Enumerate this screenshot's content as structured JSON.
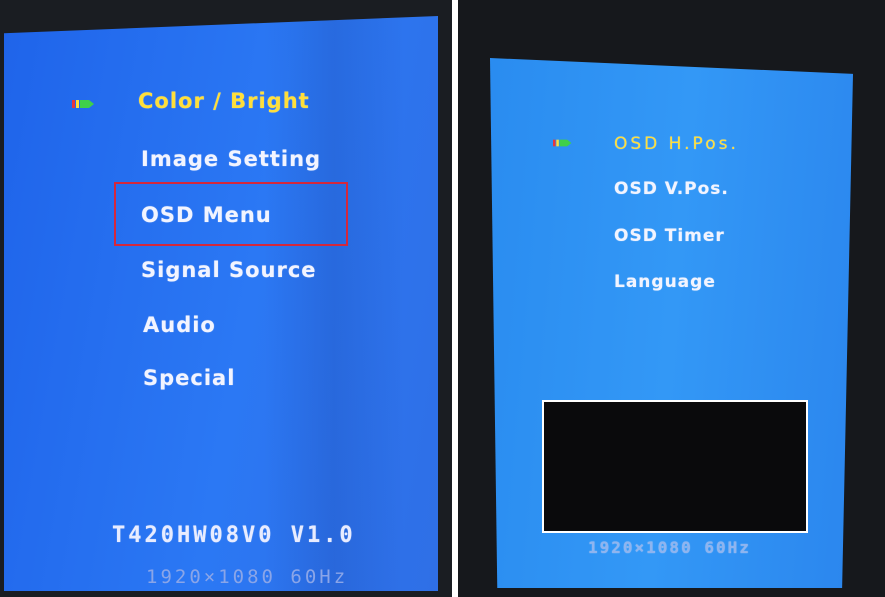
{
  "left_osd": {
    "menu_items": [
      {
        "label": "Color / Bright",
        "selected": true
      },
      {
        "label": "Image  Setting",
        "selected": false
      },
      {
        "label": "OSD  Menu",
        "selected": false,
        "highlighted": true
      },
      {
        "label": "Signal  Source",
        "selected": false
      },
      {
        "label": "Audio",
        "selected": false
      },
      {
        "label": "Special",
        "selected": false
      }
    ],
    "model_version": "T420HW08V0  V1.0",
    "resolution": "1920×1080  60Hz",
    "selector_icon": "arrow-cursor-icon",
    "highlight_color": "#d4283c",
    "background_color": "#2b78f4",
    "selected_color": "#ffdf3a"
  },
  "right_osd": {
    "menu_items": [
      {
        "label": "OSD  H.Pos.",
        "selected": true
      },
      {
        "label": "OSD  V.Pos.",
        "selected": false
      },
      {
        "label": "OSD  Timer",
        "selected": false
      },
      {
        "label": "Language",
        "selected": false
      }
    ],
    "resolution": "1920×1080  60Hz",
    "selector_icon": "arrow-cursor-icon",
    "background_color": "#3398f6",
    "selected_color": "#ffdf3a"
  }
}
